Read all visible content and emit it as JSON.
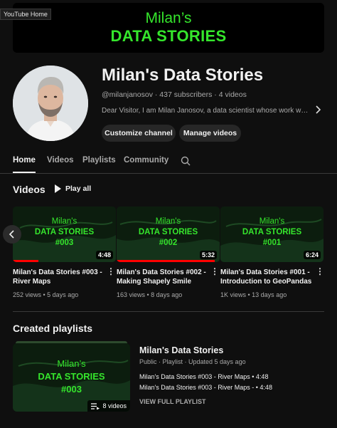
{
  "tooltip": "YouTube Home",
  "banner": {
    "line1": "Milan’s",
    "line2": "DATA STORIES"
  },
  "channel": {
    "name": "Milan's Data Stories",
    "meta": "@milanjanosov · 437 subscribers · 4 videos",
    "description": "Dear Visitor, I am Milan Janosov, a data scientist whose work was featured",
    "buttons": {
      "customize": "Customize channel",
      "manage": "Manage videos"
    }
  },
  "tabs": [
    "Home",
    "Videos",
    "Playlists",
    "Community"
  ],
  "videos_section": {
    "title": "Videos",
    "play_all": "Play all",
    "items": [
      {
        "thumb_line1": "Milan's",
        "thumb_line2": "DATA STORIES",
        "thumb_line3": "#003",
        "duration": "4:48",
        "progress": 0.25,
        "title": "Milan's Data Stories #003 - River Maps",
        "meta": "252 views • 5 days ago"
      },
      {
        "thumb_line1": "Milan's",
        "thumb_line2": "DATA STORIES",
        "thumb_line3": "#002",
        "duration": "5:32",
        "progress": 0.95,
        "title": "Milan's Data Stories #002 - Making Shapely Smile",
        "meta": "163 views • 8 days ago"
      },
      {
        "thumb_line1": "Milan's",
        "thumb_line2": "DATA STORIES",
        "thumb_line3": "#001",
        "duration": "6:24",
        "progress": 0.0,
        "title": "Milan's Data Stories #001 - Introduction to GeoPandas",
        "meta": "1K views • 13 days ago"
      }
    ]
  },
  "playlists_section": {
    "title": "Created playlists",
    "playlist": {
      "thumb_line1": "Milan’s",
      "thumb_line2": "DATA STORIES",
      "thumb_line3": "#003",
      "count": "8 videos",
      "title": "Milan's Data Stories",
      "meta": "Public · Playlist · Updated 5 days ago",
      "lines": [
        "Milan's Data Stories #003 - River Maps • 4:48",
        "Milan's Data Stories #003 - River Maps - • 4:48"
      ],
      "view_full": "VIEW FULL PLAYLIST"
    }
  },
  "colors": {
    "accent_green": "#35e62c",
    "progress_red": "#ff0000",
    "background": "#0f0f0f"
  },
  "icons": [
    "search-icon",
    "play-icon",
    "chevron-right-icon",
    "chevron-left-icon",
    "more-vert-icon",
    "playlist-icon"
  ]
}
